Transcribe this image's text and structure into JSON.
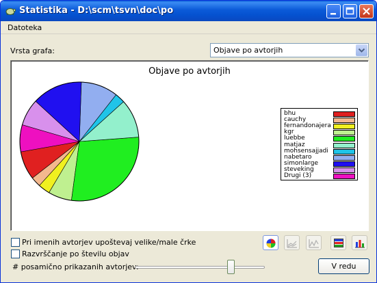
{
  "window": {
    "title": "Statistika - D:\\scm\\tsvn\\doc\\po"
  },
  "menu": {
    "file_label": "Datoteka"
  },
  "graph_type": {
    "label": "Vrsta grafa:",
    "selected": "Objave po avtorjih"
  },
  "chart_data": {
    "type": "pie",
    "title": "Objave po avtorjih",
    "legend_position": "right",
    "slices": [
      {
        "name": "bhu",
        "value": 8.5,
        "color": "#e02020"
      },
      {
        "name": "cauchy",
        "value": 3.0,
        "color": "#f4b88e"
      },
      {
        "name": "fernandonajera",
        "value": 3.5,
        "color": "#f0f020"
      },
      {
        "name": "kgr",
        "value": 7.0,
        "color": "#bff090"
      },
      {
        "name": "luebbe",
        "value": 31.0,
        "color": "#20ee20"
      },
      {
        "name": "matjaz",
        "value": 11.5,
        "color": "#93f0cc"
      },
      {
        "name": "mohsensajjadi",
        "value": 3.0,
        "color": "#20c4e8"
      },
      {
        "name": "nabetaro",
        "value": 11.0,
        "color": "#92aef0"
      },
      {
        "name": "simonlarge",
        "value": 15.0,
        "color": "#2010f0"
      },
      {
        "name": "steveking",
        "value": 8.0,
        "color": "#d890ec"
      },
      {
        "name": "Drugi (3)",
        "value": 8.0,
        "color": "#ee10c0"
      }
    ]
  },
  "options": {
    "case_label": "Pri imenih avtorjev upoštevaj velike/male črke",
    "sort_label": "Razvrščanje po številu objav",
    "slider_label": "# posamično prikazanih avtorjev:",
    "slider_value_fraction": 0.75
  },
  "buttons": {
    "ok_label": "V redu"
  }
}
